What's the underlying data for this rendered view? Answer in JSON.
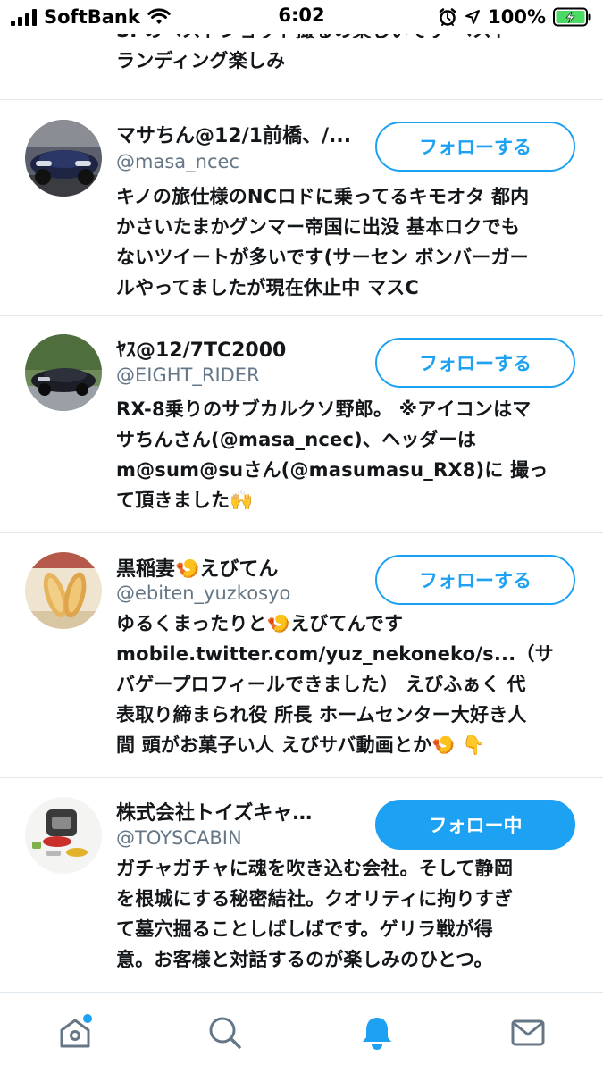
{
  "status_bar": {
    "carrier": "SoftBank",
    "time": "6:02",
    "battery": "100%"
  },
  "top_partial": {
    "bio": "SPのベストショット撮るの楽しいです ベスト\nランディング楽しみ"
  },
  "users": [
    {
      "name": "マサちん@12/1前橋、/...",
      "handle": "@masa_ncec",
      "bio": "キノの旅仕様のNCロドに乗ってるキモオタ 都内\nかさいたまかグンマー帝国に出没 基本ロクでも\nないツイートが多いです(サーセン ボンバーガー\nルやってましたが現在休止中 マスC",
      "button": "フォローする"
    },
    {
      "name": "ﾔｽ@12/7TC2000",
      "handle": "@EIGHT_RIDER",
      "bio": "RX-8乗りのサブカルクソ野郎。 ※アイコンはマ\nサちんさん(@masa_ncec)、ヘッダーは\nm@sum@suさん(@masumasu_RX8)に 撮っ\nて頂きました🙌",
      "button": "フォローする"
    },
    {
      "name": "黒稲妻🍤えびてん",
      "handle": "@ebiten_yuzkosyo",
      "bio": "ゆるくまったりと🍤えびてんです\nmobile.twitter.com/yuz_nekoneko/s...（サ\nバゲープロフィールできました） えびふぁく 代\n表取り締まられ役 所長 ホームセンター大好き人\n間 頭がお菓子い人 えびサバ動画とか🍤 👇",
      "button": "フォローする"
    },
    {
      "name": "株式会社トイズキャ…",
      "handle": "@TOYSCABIN",
      "bio": "ガチャガチャに魂を吹き込む会社。そして静岡\nを根城にする秘密結社。クオリティに拘りすぎ\nて墓穴掘ることしばしばです。ゲリラ戦が得\n意。お客様と対話するのが楽しみのひとつ。",
      "button": "フォロー中"
    }
  ],
  "tabs": [
    {
      "icon": "home-icon"
    },
    {
      "icon": "search-icon"
    },
    {
      "icon": "notifications-icon"
    },
    {
      "icon": "messages-icon"
    }
  ],
  "colors": {
    "accent": "#1da1f2",
    "handle_gray": "#657786",
    "divider": "#e1e8ed",
    "battery_green": "#4cd964"
  }
}
